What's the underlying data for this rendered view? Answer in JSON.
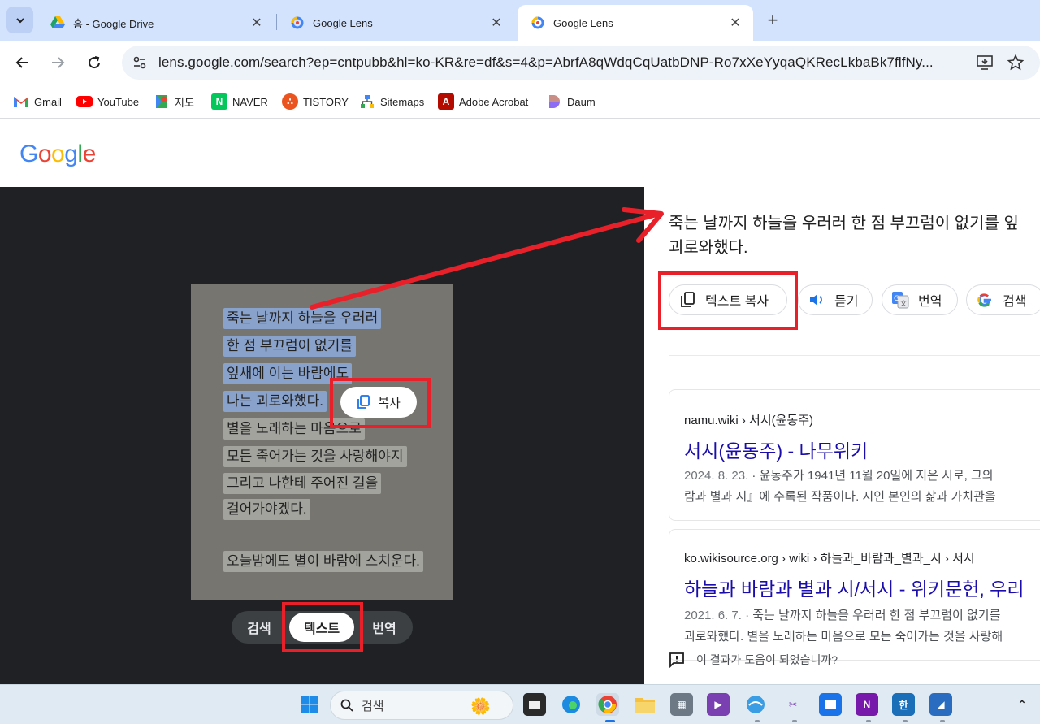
{
  "browser": {
    "tabs": [
      {
        "title": "홈 - Google Drive",
        "favicon": "google-drive-icon"
      },
      {
        "title": "Google Lens",
        "favicon": "google-lens-icon"
      },
      {
        "title": "Google Lens",
        "favicon": "google-lens-icon",
        "active": true
      }
    ],
    "url": "lens.google.com/search?ep=cntpubb&hl=ko-KR&re=df&s=4&p=AbrfA8qWdqCqUatbDNP-Ro7xXeYyqaQKRecLkbaBk7flfNy...",
    "bookmarks": [
      "Gmail",
      "YouTube",
      "지도",
      "NAVER",
      "TISTORY",
      "Sitemaps",
      "Adobe Acrobat",
      "Daum"
    ]
  },
  "google_logo": "Google",
  "photo_lines": [
    "죽는 날까지 하늘을 우러러",
    "한 점 부끄럼이 없기를",
    "잎새에 이는 바람에도",
    "나는 괴로와했다.",
    "별을 노래하는 마음으로",
    "모든 죽어가는 것을 사랑해야지",
    "그리고 나한테 주어진 길을",
    "걸어가야겠다.",
    "오늘밤에도 별이 바람에 스치운다."
  ],
  "copy_popup": "복사",
  "modes": [
    "검색",
    "텍스트",
    "번역"
  ],
  "selected_mode": "텍스트",
  "result_text": [
    "죽는 날까지 하늘을 우러러 한 점 부끄럼이 없기를 잎",
    "괴로와했다."
  ],
  "actions": [
    "텍스트 복사",
    "듣기",
    "번역",
    "검색"
  ],
  "results": [
    {
      "source": "namu.wiki › 서시(윤동주)",
      "title": "서시(윤동주) - 나무위키",
      "date": "2024. 8. 23.",
      "snippet1": " · 윤동주가 1941년 11월 20일에 지은 시로, 그의",
      "snippet2": "람과 별과 시』에 수록된 작품이다. 시인 본인의 삶과 가치관을"
    },
    {
      "source": "ko.wikisource.org › wiki › 하늘과_바람과_별과_시 › 서시",
      "title": "하늘과 바람과 별과 시/서시 - 위키문헌, 우리",
      "date": "2021. 6. 7.",
      "snippet1": " · 죽는 날까지 하늘을 우러러 한 점 부끄럼이 없기를",
      "snippet2": "괴로와했다. 별을 노래하는 마음으로 모든 죽어가는 것을 사랑해"
    }
  ],
  "feedback": "이 결과가 도움이 되었습니까?",
  "taskbar": {
    "search_placeholder": "검색"
  },
  "colors": {
    "annotation_red": "#e8202a",
    "link_blue": "#1a0dab",
    "tabstrip": "#d3e3fd"
  }
}
